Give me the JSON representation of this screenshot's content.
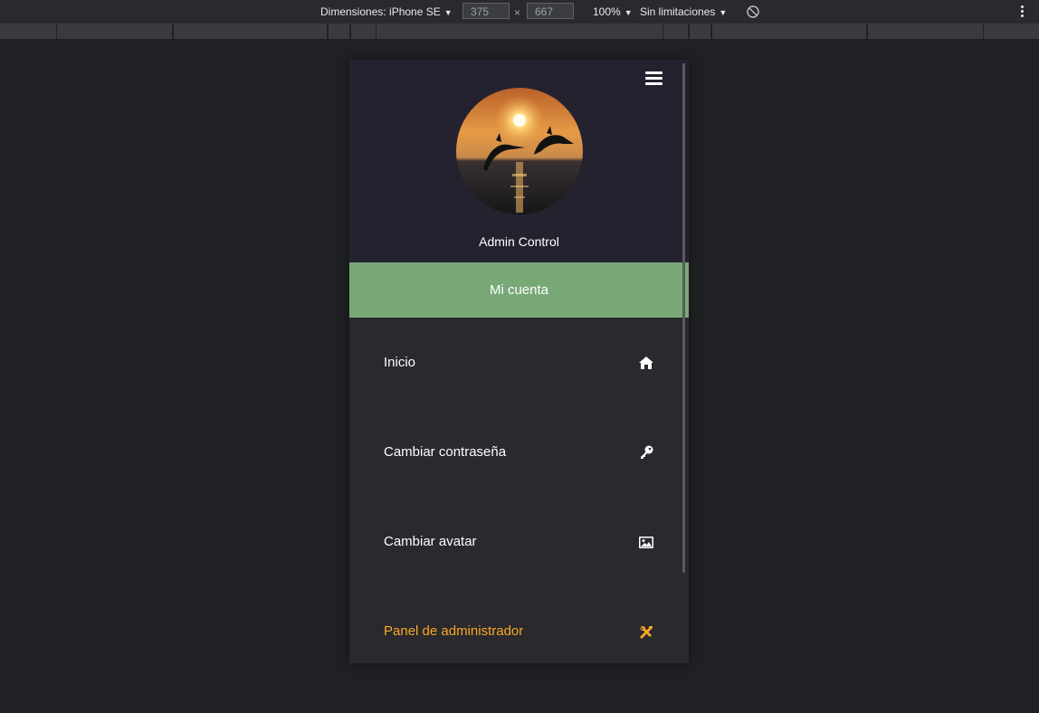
{
  "devtools": {
    "dimensions_label": "Dimensiones: iPhone SE",
    "width_value": "375",
    "height_value": "667",
    "times_symbol": "×",
    "zoom": "100%",
    "throttling": "Sin limitaciones",
    "caret": "▼",
    "icons": [
      "rotate-icon",
      "more-vert-icon"
    ]
  },
  "app": {
    "username": "Admin Control",
    "account_button": "Mi cuenta",
    "menu": [
      {
        "label": "Inicio",
        "icon": "home-icon"
      },
      {
        "label": "Cambiar contraseña",
        "icon": "key-icon"
      },
      {
        "label": "Cambiar avatar",
        "icon": "image-icon"
      },
      {
        "label": "Panel de administrador",
        "icon": "tools-icon",
        "color": "#f9a825"
      }
    ],
    "colors": {
      "header_bg": "#25222f",
      "account_button_bg": "#79a877",
      "menu_bg": "#29292e",
      "admin_accent": "#f9a825"
    }
  }
}
